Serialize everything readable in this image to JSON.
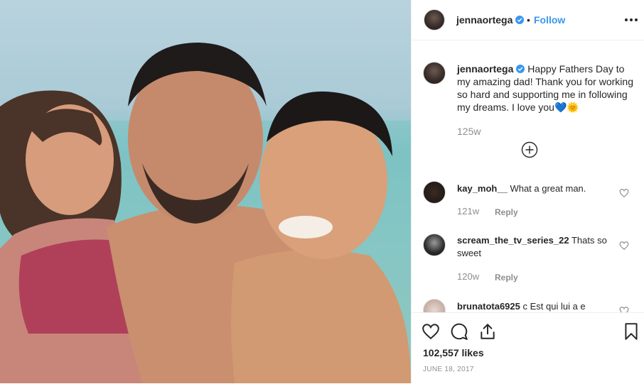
{
  "post": {
    "photo_description": "",
    "author": "jennaortega",
    "follow_label": "Follow",
    "header_separator": "•",
    "caption_text": "Happy Fathers Day to my amazing dad! Thank you for working so hard and supporting me in following my dreams. I love you💙🌞",
    "caption_time": "125w",
    "likes": "102,557 likes",
    "date": "JUNE 18, 2017"
  },
  "comments": [
    {
      "user": "kay_moh__",
      "text": "What a great man.",
      "time": "121w",
      "reply_label": "Reply"
    },
    {
      "user": "scream_the_tv_series_22",
      "text": "Thats so sweet",
      "time": "120w",
      "reply_label": "Reply"
    },
    {
      "user": "brunatota6925",
      "text": "c Est qui lui a e"
    }
  ],
  "icons": {
    "verified": "verified-badge-icon",
    "more": "more-options-icon",
    "load_more": "load-more-comments-icon",
    "like": "heart-icon",
    "comment": "comment-icon",
    "share": "share-icon",
    "save": "bookmark-icon"
  },
  "colors": {
    "link": "#3897f0",
    "muted": "#8e8e8e",
    "text": "#262626",
    "border": "#efefef"
  }
}
